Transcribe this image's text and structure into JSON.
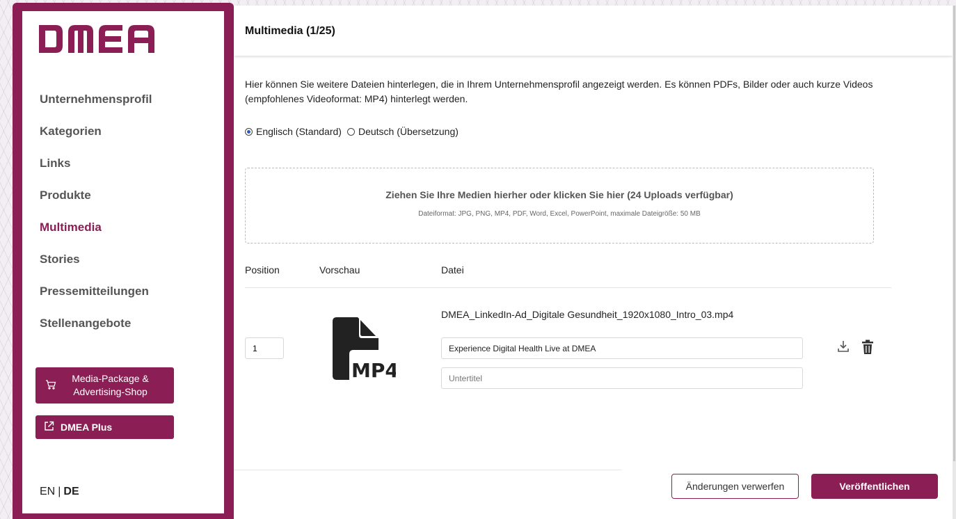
{
  "brand": {
    "logo_text": "DMEA",
    "color": "#8b1f55"
  },
  "sidebar": {
    "items": [
      {
        "label": "Unternehmensprofil",
        "active": false
      },
      {
        "label": "Kategorien",
        "active": false
      },
      {
        "label": "Links",
        "active": false
      },
      {
        "label": "Produkte",
        "active": false
      },
      {
        "label": "Multimedia",
        "active": true
      },
      {
        "label": "Stories",
        "active": false
      },
      {
        "label": "Pressemitteilungen",
        "active": false
      },
      {
        "label": "Stellenangebote",
        "active": false
      }
    ],
    "shop_button": {
      "line1": "Media-Package &",
      "line2": "Advertising-Shop",
      "icon": "cart-icon"
    },
    "plus_button": {
      "label": "DMEA Plus",
      "icon": "external-link-icon"
    },
    "language": {
      "en": "EN",
      "separator": "|",
      "de": "DE",
      "current": "DE"
    }
  },
  "header": {
    "title": "Multimedia (1/25)"
  },
  "main": {
    "intro": "Hier können Sie weitere Dateien hinterlegen, die in Ihrem Unternehmensprofil angezeigt werden. Es können PDFs, Bilder oder auch kurze Videos (empfohlenes Videoformat: MP4) hinterlegt werden.",
    "language_options": [
      {
        "label": "Englisch (Standard)",
        "checked": true
      },
      {
        "label": "Deutsch (Übersetzung)",
        "checked": false
      }
    ],
    "dropzone": {
      "title": "Ziehen Sie Ihre Medien hierher oder klicken Sie hier (24 Uploads verfügbar)",
      "subtitle": "Dateiformat: JPG, PNG, MP4, PDF, Word, Excel, PowerPoint, maximale Dateigröße: 50 MB"
    },
    "table": {
      "headers": {
        "position": "Position",
        "preview": "Vorschau",
        "file": "Datei"
      },
      "rows": [
        {
          "position": "1",
          "preview_icon": "mp4-file-icon",
          "preview_label": "MP4",
          "filename": "DMEA_LinkedIn-Ad_Digitale Gesundheit_1920x1080_Intro_03.mp4",
          "title_value": "Experience Digital Health Live at DMEA",
          "subtitle_placeholder": "Untertitel",
          "actions": [
            "download-icon",
            "trash-icon"
          ]
        }
      ]
    }
  },
  "footer": {
    "discard": "Änderungen verwerfen",
    "publish": "Veröffentlichen"
  }
}
